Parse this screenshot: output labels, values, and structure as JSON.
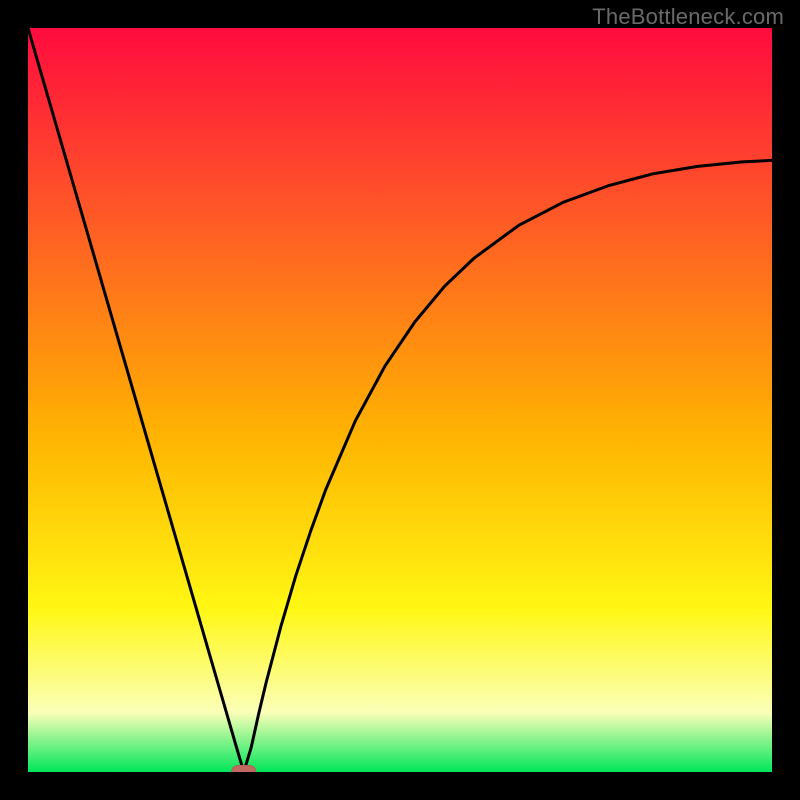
{
  "watermark": "TheBottleneck.com",
  "colors": {
    "bg_black": "#000000",
    "curve": "#000000",
    "marker_fill": "#bf6a60",
    "marker_stroke": "#b26057",
    "grad_top": "#ff0b3e",
    "grad_upper": "#ff4f2a",
    "grad_mid": "#ffb401",
    "grad_lower": "#fff713",
    "grad_pale": "#fbffb8",
    "grad_green": "#00e659"
  },
  "chart_data": {
    "type": "line",
    "title": "",
    "xlabel": "",
    "ylabel": "",
    "xlim": [
      0,
      100
    ],
    "ylim": [
      0,
      100
    ],
    "series": [
      {
        "name": "bottleneck-curve",
        "x": [
          0,
          2,
          4,
          6,
          8,
          10,
          12,
          14,
          16,
          18,
          20,
          22,
          24,
          26,
          28,
          29,
          30,
          31,
          32,
          34,
          36,
          38,
          40,
          44,
          48,
          52,
          56,
          60,
          66,
          72,
          78,
          84,
          90,
          96,
          100
        ],
        "y": [
          100,
          93.1,
          86.2,
          79.3,
          72.4,
          65.5,
          58.6,
          51.7,
          44.8,
          37.9,
          31.0,
          24.1,
          17.2,
          10.3,
          3.4,
          0.0,
          3.3,
          7.8,
          12.0,
          19.6,
          26.4,
          32.4,
          37.9,
          47.2,
          54.6,
          60.5,
          65.3,
          69.1,
          73.5,
          76.6,
          78.8,
          80.4,
          81.4,
          82.0,
          82.2
        ]
      }
    ],
    "marker": {
      "x": 29,
      "y": 0
    },
    "gradient_stops": [
      {
        "pct": 0,
        "color": "#ff0b3e"
      },
      {
        "pct": 22,
        "color": "#ff4f2a"
      },
      {
        "pct": 55,
        "color": "#ffb401"
      },
      {
        "pct": 78,
        "color": "#fff713"
      },
      {
        "pct": 92,
        "color": "#fbffb8"
      },
      {
        "pct": 100,
        "color": "#00e659"
      }
    ]
  }
}
